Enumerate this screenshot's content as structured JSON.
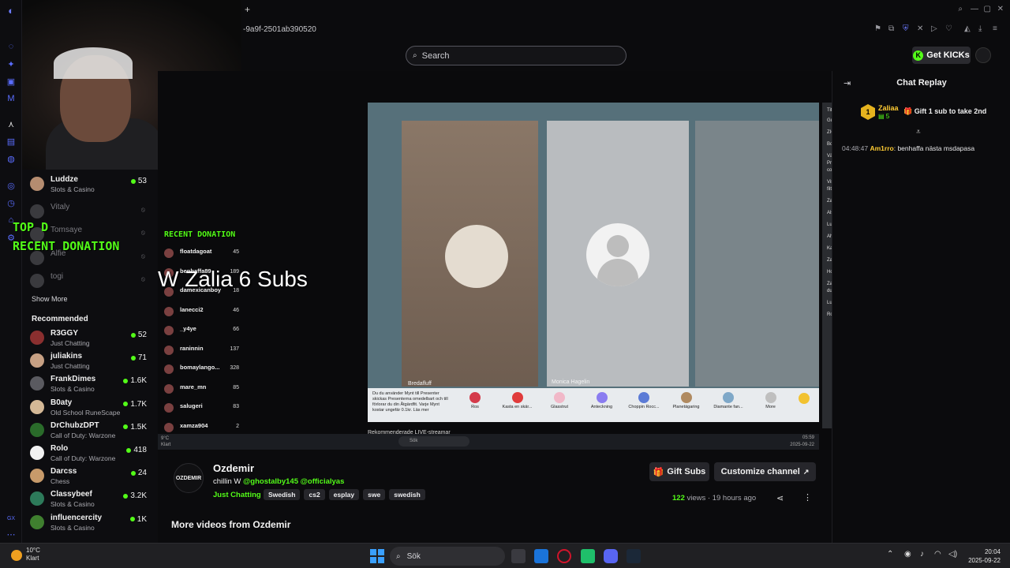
{
  "browser": {
    "new_tab": "+",
    "url_fragment": "-9a9f-2501ab390520"
  },
  "header": {
    "search_placeholder": "Search",
    "get_kicks_label": "Get KICKs",
    "kick_badge": "K"
  },
  "sidebar": {
    "following": [
      {
        "name": "Luddze",
        "category": "Slots & Casino",
        "viewers": "53",
        "live": true
      },
      {
        "name": "Vitaly",
        "category": "",
        "viewers": "",
        "live": false
      },
      {
        "name": "Tomsaye",
        "category": "",
        "viewers": "",
        "live": false
      },
      {
        "name": "Alfie",
        "category": "",
        "viewers": "",
        "live": false
      },
      {
        "name": "togi",
        "category": "",
        "viewers": "",
        "live": false
      }
    ],
    "show_more": "Show More",
    "recommended_label": "Recommended",
    "recommended": [
      {
        "name": "R3GGY",
        "category": "Just Chatting",
        "viewers": "52"
      },
      {
        "name": "juliakins",
        "category": "Just Chatting",
        "viewers": "71"
      },
      {
        "name": "FrankDimes",
        "category": "Slots & Casino",
        "viewers": "1.6K"
      },
      {
        "name": "B0aty",
        "category": "Old School RuneScape",
        "viewers": "1.7K"
      },
      {
        "name": "DrChubzDPT",
        "category": "Call of Duty: Warzone",
        "viewers": "1.5K"
      },
      {
        "name": "Rolo",
        "category": "Call of Duty: Warzone",
        "viewers": "418"
      },
      {
        "name": "Darcss",
        "category": "Chess",
        "viewers": "24"
      },
      {
        "name": "Classybeef",
        "category": "Slots & Casino",
        "viewers": "3.2K"
      },
      {
        "name": "influencercity",
        "category": "Slots & Casino",
        "viewers": "1K"
      }
    ]
  },
  "stream_overlay": {
    "top_d": "TOP D",
    "recent_donation": "RECENT DONATION",
    "recent_donation_small": "RECENT DONATION",
    "w_zalia": "W Zalia 6 Subs",
    "donations": [
      {
        "name": "floatdagoat",
        "value": "45"
      },
      {
        "name": "benhaffa89",
        "value": "189"
      },
      {
        "name": "damexicanboy",
        "value": "18"
      },
      {
        "name": "lanecci2",
        "value": "46"
      },
      {
        "name": "_y4ye",
        "value": "66"
      },
      {
        "name": "raninnin",
        "value": "137"
      },
      {
        "name": "bomaylango...",
        "value": "328"
      },
      {
        "name": "mare_mn",
        "value": "85"
      },
      {
        "name": "salugeri",
        "value": "83"
      },
      {
        "name": "xamza904",
        "value": "2"
      }
    ],
    "tile_label_1": "Bredafluff",
    "tile_label_2": "Monica Hagelin",
    "gifts": [
      {
        "name": "Ros",
        "color": "#d43a4a"
      },
      {
        "name": "Kasta en skär...",
        "color": "#e03b3b"
      },
      {
        "name": "Glasstrut",
        "color": "#f1b8c8"
      },
      {
        "name": "Anteckning",
        "color": "#8a7cf0"
      },
      {
        "name": "Choppin Rocc...",
        "color": "#5b7bd6"
      },
      {
        "name": "Planetägaring",
        "color": "#b08a60"
      },
      {
        "name": "Diamante fan...",
        "color": "#7fa8c8"
      },
      {
        "name": "More",
        "color": "#bfbfbf"
      }
    ],
    "gift_desc": "Du du använder Mynt till Presenter skickas Presenterna omedelbart och till förlorar du din Åtgärdfit. Varje Mynt kostar ungefär 0.1kr. Läs mer",
    "tiktok_chat_viewers": "Tittare · 189",
    "tiktok_chat_lines": [
      "Guldish 89",
      "ZIGZAGG 48",
      "Boss 21",
      "Välkommen till LIVE! Ha kul och skicka Presenter. Kom ihåg att följa våra communityregler.",
      "Vissa kommentarer i denna LIVE-sändning har filtrerats",
      "Zandra Lundberg: mejnej jag livar inte",
      "Alshom",
      "Luigi29",
      "Ahla bemmmmm",
      "Kasellbullo",
      "Zandra Lundberg: han är sugen jobna 5min",
      "Hon säger sätt",
      "Zandra Lundberg: haha nej är du galen gå upp du",
      "Luigi29",
      "Rolf Tornell: har gått med"
    ],
    "rec_live": "Rekommenderade LIVE-streamar",
    "inner_taskbar_search": "Sök",
    "inner_time": "05:59",
    "inner_date": "2025-09-22",
    "inner_temp": "9°C",
    "inner_weather": "Klart"
  },
  "chat": {
    "title": "Chat Replay",
    "pinned_level": "1",
    "pinned_user": "Zaliaa",
    "pinned_count": "5",
    "pinned_text": "Gift 1 sub to take 2nd",
    "messages": [
      {
        "time": "04:48:47",
        "user": "Am1rro",
        "text": "benhaffa nästa msdapasa"
      }
    ]
  },
  "video": {
    "channel_avatar_text": "OZDEMIR",
    "channel_name": "Ozdemir",
    "title_prefix": "chillin W",
    "mention_1": "@ghostalby145",
    "mention_2": "@officialyas",
    "category": "Just Chatting",
    "tags": [
      "Swedish",
      "cs2",
      "esplay",
      "swe",
      "swedish"
    ],
    "gift_subs_label": "Gift Subs",
    "customize_label": "Customize channel",
    "views_count": "122",
    "views_word": "views",
    "ago": "· 19 hours ago",
    "more_videos": "More videos from Ozdemir"
  },
  "taskbar": {
    "temp": "10°C",
    "weather": "Klart",
    "search": "Sök",
    "time": "20:04",
    "date": "2025-09-22"
  }
}
